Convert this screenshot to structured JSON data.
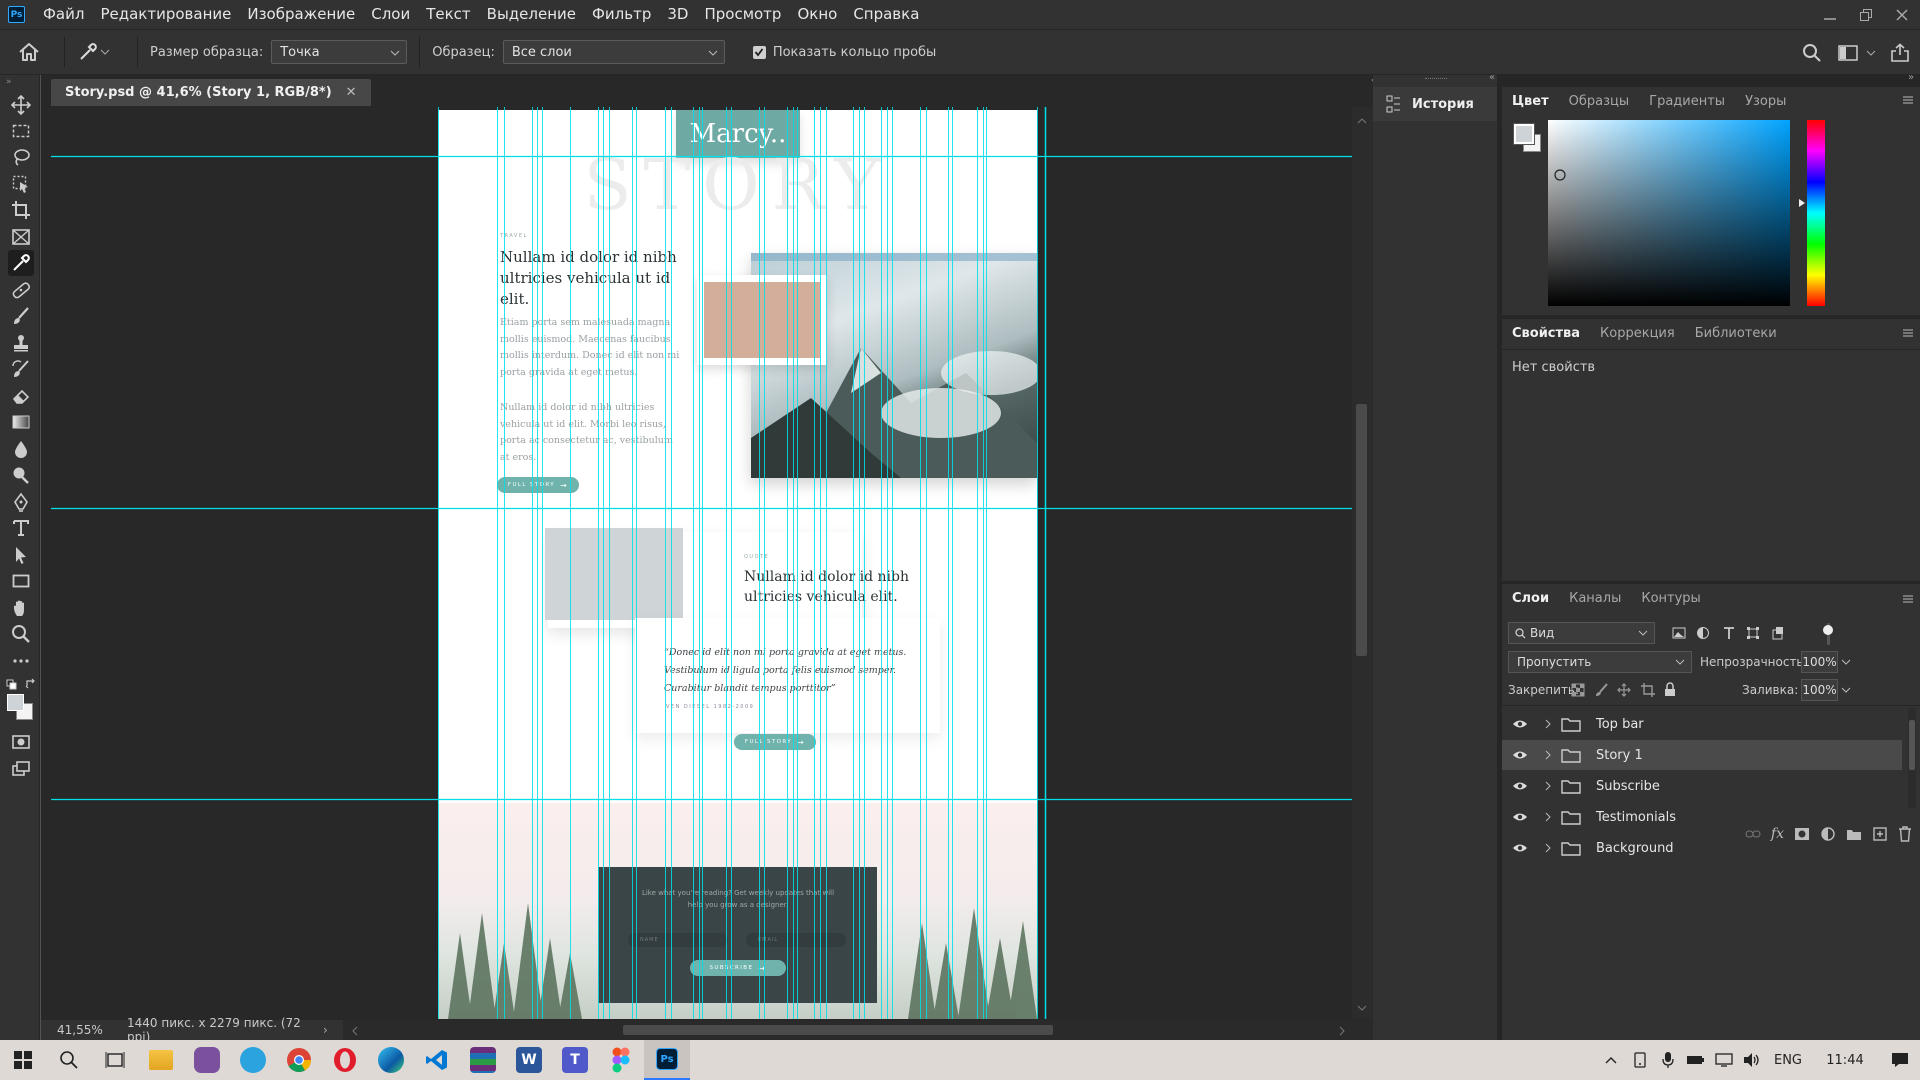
{
  "menubar": {
    "logo": "Ps",
    "items": [
      "Файл",
      "Редактирование",
      "Изображение",
      "Слои",
      "Текст",
      "Выделение",
      "Фильтр",
      "3D",
      "Просмотр",
      "Окно",
      "Справка"
    ]
  },
  "options": {
    "sample_size_label": "Размер образца:",
    "sample_size_value": "Точка",
    "sample_label": "Образец:",
    "sample_value": "Все слои",
    "show_ring_label": "Показать кольцо пробы",
    "show_ring_checked": true
  },
  "document": {
    "tab_title": "Story.psd @ 41,6% (Story 1, RGB/8*)",
    "zoom": "41,55%",
    "doc_info": "1440 пикс. x 2279 пикс. (72 ppi)"
  },
  "mockup": {
    "logo": "Marcy..",
    "story_bg_word": "STORY",
    "travel_tag": "TRAVEL",
    "heading1": "Nullam id dolor id nibh ultricies vehicula ut id elit.",
    "para1": "Etiam porta sem malesuada magna mollis euismod. Maecenas faucibus mollis interdum. Donec id elit non mi porta gravida at eget metus.",
    "para2": "Nullam id dolor id nibh ultricies vehicula ut id elit. Morbi leo risus, porta ac consectetur ac, vestibulum at eros.",
    "button1": "FULL STORY",
    "quote_tag": "QUOTE",
    "heading2": "Nullam id dolor id nibh ultricies vehicula elit.",
    "quote": "“Donec id elit non mi porta gravida at eget metus. Vestibulum id ligula porta felis euismod semper. Curabitur blandit tempus porttitor”",
    "quote_author": "VEN DIESEL 1982-2009",
    "button2": "FULL STORY",
    "subscribe_text": "Like what you're reading? Get weekly updates that will help you grow as a designer.",
    "name_placeholder": "NAME",
    "email_placeholder": "EMAIL",
    "subscribe_button": "SUBSCRIBE",
    "swatch_color": "#d3ae9a",
    "accent_color": "#6fb3ac",
    "guide_color": "#00e0e8"
  },
  "history_panel": {
    "label": "История"
  },
  "color_panel": {
    "tabs": [
      "Цвет",
      "Образцы",
      "Градиенты",
      "Узоры"
    ],
    "hue_color": "#00a3ff"
  },
  "properties_panel": {
    "tabs": [
      "Свойства",
      "Коррекция",
      "Библиотеки"
    ],
    "empty_text": "Нет свойств"
  },
  "layers_panel": {
    "tabs": [
      "Слои",
      "Каналы",
      "Контуры"
    ],
    "filter_value": "Вид",
    "blend_mode": "Пропустить",
    "opacity_label": "Непрозрачность:",
    "opacity_value": "100%",
    "lock_label": "Закрепить:",
    "fill_label": "Заливка:",
    "fill_value": "100%",
    "layers": [
      "Top bar",
      "Story 1",
      "Subscribe",
      "Testimonials",
      "Background"
    ],
    "selected_index": 1
  },
  "taskbar": {
    "language": "ENG",
    "time": "11:44"
  }
}
